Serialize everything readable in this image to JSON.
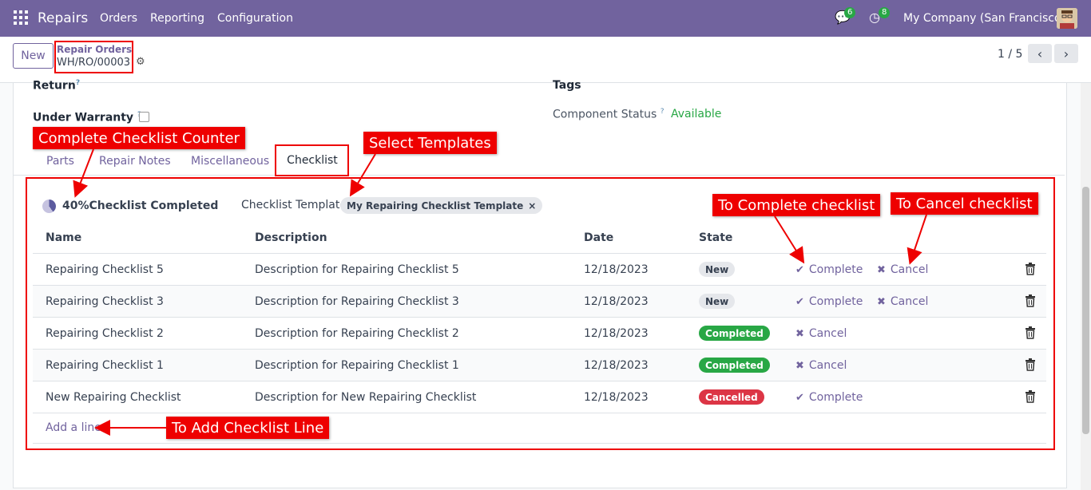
{
  "navbar": {
    "app_name": "Repairs",
    "menu": [
      "Orders",
      "Reporting",
      "Configuration"
    ],
    "messages_count": "6",
    "activities_count": "8",
    "company": "My Company (San Francisco)"
  },
  "control_panel": {
    "new_label": "New",
    "breadcrumb_parent": "Repair Orders",
    "record_name": "WH/RO/00003",
    "pager": "1 / 5"
  },
  "form": {
    "return_label": "Return",
    "tags_label": "Tags",
    "warranty_label": "Under Warranty",
    "component_status_label": "Component Status",
    "component_status_value": "Available"
  },
  "tabs": [
    "Parts",
    "Repair Notes",
    "Miscellaneous",
    "Checklist"
  ],
  "checklist": {
    "progress_value": 40,
    "counter_text": "40%Checklist Completed",
    "template_label": "Checklist Template",
    "template_value": "My Repairing Checklist Template",
    "columns": [
      "Name",
      "Description",
      "Date",
      "State"
    ],
    "rows": [
      {
        "name": "Repairing Checklist 5",
        "description": "Description for Repairing Checklist 5",
        "date": "12/18/2023",
        "state": "New",
        "complete": "Complete",
        "cancel": "Cancel"
      },
      {
        "name": "Repairing Checklist 3",
        "description": "Description for Repairing Checklist 3",
        "date": "12/18/2023",
        "state": "New",
        "complete": "Complete",
        "cancel": "Cancel"
      },
      {
        "name": "Repairing Checklist 2",
        "description": "Description for Repairing Checklist 2",
        "date": "12/18/2023",
        "state": "Completed",
        "complete": "",
        "cancel": "Cancel"
      },
      {
        "name": "Repairing Checklist 1",
        "description": "Description for Repairing Checklist 1",
        "date": "12/18/2023",
        "state": "Completed",
        "complete": "",
        "cancel": "Cancel"
      },
      {
        "name": "New Repairing Checklist",
        "description": "Description for New Repairing Checklist",
        "date": "12/18/2023",
        "state": "Cancelled",
        "complete": "Complete",
        "cancel": ""
      }
    ],
    "add_line": "Add a line"
  },
  "annotations": {
    "counter": "Complete Checklist Counter",
    "templates": "Select Templates",
    "complete": "To Complete checklist",
    "cancel": "To Cancel checklist",
    "add_line": "To Add Checklist Line"
  },
  "colors": {
    "brand": "#71639e",
    "annotation": "#ee0000",
    "success": "#28a745",
    "danger": "#dc3545"
  }
}
